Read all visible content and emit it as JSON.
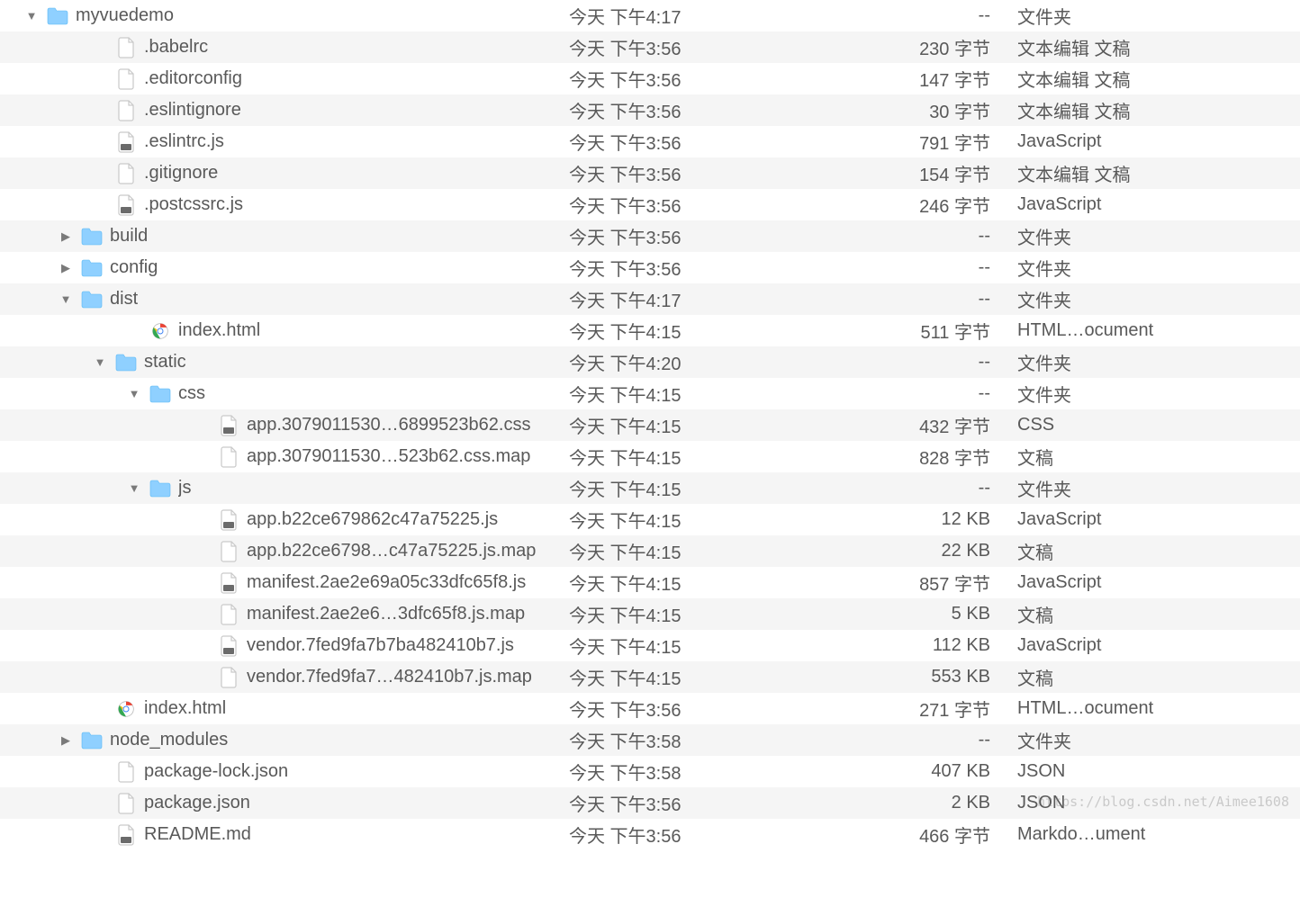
{
  "watermark": "https://blog.csdn.net/Aimee1608",
  "rows": [
    {
      "indent": 0,
      "disc": "down",
      "icon": "folder",
      "name": "myvuedemo",
      "date": "今天 下午4:17",
      "size": "--",
      "kind": "文件夹"
    },
    {
      "indent": 2,
      "disc": "none",
      "icon": "file",
      "name": ".babelrc",
      "date": "今天 下午3:56",
      "size": "230 字节",
      "kind": "文本编辑 文稿"
    },
    {
      "indent": 2,
      "disc": "none",
      "icon": "file",
      "name": ".editorconfig",
      "date": "今天 下午3:56",
      "size": "147 字节",
      "kind": "文本编辑 文稿"
    },
    {
      "indent": 2,
      "disc": "none",
      "icon": "file",
      "name": ".eslintignore",
      "date": "今天 下午3:56",
      "size": "30 字节",
      "kind": "文本编辑 文稿"
    },
    {
      "indent": 2,
      "disc": "none",
      "icon": "js",
      "name": ".eslintrc.js",
      "date": "今天 下午3:56",
      "size": "791 字节",
      "kind": "JavaScript"
    },
    {
      "indent": 2,
      "disc": "none",
      "icon": "file",
      "name": ".gitignore",
      "date": "今天 下午3:56",
      "size": "154 字节",
      "kind": "文本编辑 文稿"
    },
    {
      "indent": 2,
      "disc": "none",
      "icon": "js",
      "name": ".postcssrc.js",
      "date": "今天 下午3:56",
      "size": "246 字节",
      "kind": "JavaScript"
    },
    {
      "indent": 1,
      "disc": "right",
      "icon": "folder",
      "name": "build",
      "date": "今天 下午3:56",
      "size": "--",
      "kind": "文件夹"
    },
    {
      "indent": 1,
      "disc": "right",
      "icon": "folder",
      "name": "config",
      "date": "今天 下午3:56",
      "size": "--",
      "kind": "文件夹"
    },
    {
      "indent": 1,
      "disc": "down",
      "icon": "folder",
      "name": "dist",
      "date": "今天 下午4:17",
      "size": "--",
      "kind": "文件夹"
    },
    {
      "indent": 3,
      "disc": "none",
      "icon": "chrome",
      "name": "index.html",
      "date": "今天 下午4:15",
      "size": "511 字节",
      "kind": "HTML…ocument"
    },
    {
      "indent": 2,
      "disc": "down",
      "icon": "folder",
      "name": "static",
      "date": "今天 下午4:20",
      "size": "--",
      "kind": "文件夹"
    },
    {
      "indent": 3,
      "disc": "down",
      "icon": "folder",
      "name": "css",
      "date": "今天 下午4:15",
      "size": "--",
      "kind": "文件夹"
    },
    {
      "indent": 5,
      "disc": "none",
      "icon": "css",
      "name": "app.3079011530…6899523b62.css",
      "date": "今天 下午4:15",
      "size": "432 字节",
      "kind": "CSS"
    },
    {
      "indent": 5,
      "disc": "none",
      "icon": "file",
      "name": "app.3079011530…523b62.css.map",
      "date": "今天 下午4:15",
      "size": "828 字节",
      "kind": "文稿"
    },
    {
      "indent": 3,
      "disc": "down",
      "icon": "folder",
      "name": "js",
      "date": "今天 下午4:15",
      "size": "--",
      "kind": "文件夹"
    },
    {
      "indent": 5,
      "disc": "none",
      "icon": "js",
      "name": "app.b22ce679862c47a75225.js",
      "date": "今天 下午4:15",
      "size": "12 KB",
      "kind": "JavaScript"
    },
    {
      "indent": 5,
      "disc": "none",
      "icon": "file",
      "name": "app.b22ce6798…c47a75225.js.map",
      "date": "今天 下午4:15",
      "size": "22 KB",
      "kind": "文稿"
    },
    {
      "indent": 5,
      "disc": "none",
      "icon": "js",
      "name": "manifest.2ae2e69a05c33dfc65f8.js",
      "date": "今天 下午4:15",
      "size": "857 字节",
      "kind": "JavaScript"
    },
    {
      "indent": 5,
      "disc": "none",
      "icon": "file",
      "name": "manifest.2ae2e6…3dfc65f8.js.map",
      "date": "今天 下午4:15",
      "size": "5 KB",
      "kind": "文稿"
    },
    {
      "indent": 5,
      "disc": "none",
      "icon": "js",
      "name": "vendor.7fed9fa7b7ba482410b7.js",
      "date": "今天 下午4:15",
      "size": "112 KB",
      "kind": "JavaScript"
    },
    {
      "indent": 5,
      "disc": "none",
      "icon": "file",
      "name": "vendor.7fed9fa7…482410b7.js.map",
      "date": "今天 下午4:15",
      "size": "553 KB",
      "kind": "文稿"
    },
    {
      "indent": 2,
      "disc": "none",
      "icon": "chrome",
      "name": "index.html",
      "date": "今天 下午3:56",
      "size": "271 字节",
      "kind": "HTML…ocument"
    },
    {
      "indent": 1,
      "disc": "right",
      "icon": "folder",
      "name": "node_modules",
      "date": "今天 下午3:58",
      "size": "--",
      "kind": "文件夹"
    },
    {
      "indent": 2,
      "disc": "none",
      "icon": "file",
      "name": "package-lock.json",
      "date": "今天 下午3:58",
      "size": "407 KB",
      "kind": "JSON"
    },
    {
      "indent": 2,
      "disc": "none",
      "icon": "file",
      "name": "package.json",
      "date": "今天 下午3:56",
      "size": "2 KB",
      "kind": "JSON"
    },
    {
      "indent": 2,
      "disc": "none",
      "icon": "md",
      "name": "README.md",
      "date": "今天 下午3:56",
      "size": "466 字节",
      "kind": "Markdo…ument"
    }
  ]
}
